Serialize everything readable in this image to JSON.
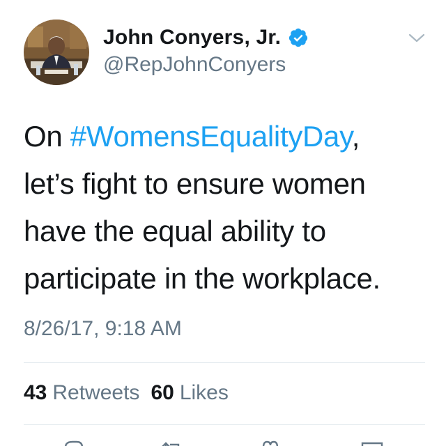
{
  "tweet": {
    "display_name": "John Conyers, Jr.",
    "handle": "@RepJohnConyers",
    "verified": true,
    "text": {
      "line1_prefix": "On ",
      "hashtag": "#WomensEqualityDay",
      "line1_suffix": ",",
      "line2": "let’s fight to ensure women",
      "line3": "have the equal ability to",
      "line4": "participate in the workplace."
    },
    "timestamp": "8/26/17, 9:18 AM",
    "stats": {
      "retweets_count": "43",
      "retweets_label": "Retweets",
      "likes_count": "60",
      "likes_label": "Likes"
    }
  },
  "icons": {
    "verified": "verified-badge-icon",
    "more": "chevron-down-icon",
    "reply": "reply-icon",
    "retweet": "retweet-icon",
    "like": "heart-icon",
    "share": "share-icon"
  },
  "colors": {
    "link": "#1da1f2",
    "secondary_text": "#657786",
    "primary_text": "#14171a",
    "divider": "#e1e8ed"
  }
}
